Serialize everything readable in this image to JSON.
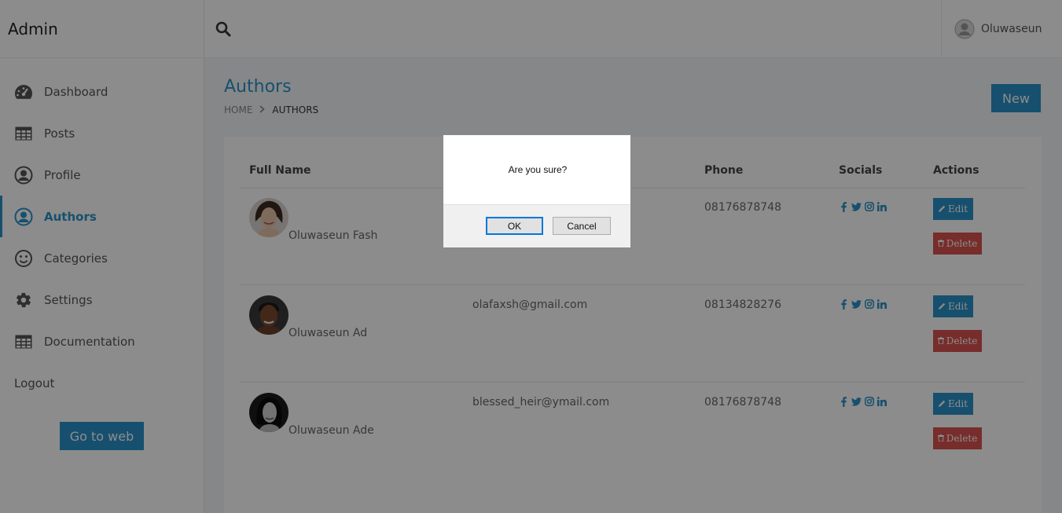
{
  "brand": "Admin",
  "sidebar": {
    "items": [
      {
        "label": "Dashboard",
        "icon": "dashboard-icon",
        "active": false
      },
      {
        "label": "Posts",
        "icon": "table-icon",
        "active": false
      },
      {
        "label": "Profile",
        "icon": "user-circle-icon",
        "active": false
      },
      {
        "label": "Authors",
        "icon": "user-circle-icon",
        "active": true
      },
      {
        "label": "Categories",
        "icon": "smile-icon",
        "active": false
      },
      {
        "label": "Settings",
        "icon": "gear-icon",
        "active": false
      },
      {
        "label": "Documentation",
        "icon": "table-icon",
        "active": false
      }
    ],
    "logout": "Logout",
    "go_web": "Go to web"
  },
  "topbar": {
    "search_icon": "search-icon",
    "user_name": "Oluwaseun"
  },
  "page": {
    "title": "Authors",
    "breadcrumb": {
      "home": "HOME",
      "current": "AUTHORS"
    },
    "new_button": "New"
  },
  "table": {
    "headers": {
      "name": "Full Name",
      "phone": "Phone",
      "socials": "Socials",
      "actions": "Actions"
    },
    "rows": [
      {
        "name": "Oluwaseun Fash",
        "email": "",
        "phone": "08176878748"
      },
      {
        "name": "Oluwaseun Ad",
        "email": "olafaxsh@gmail.com",
        "phone": "08134828276"
      },
      {
        "name": "Oluwaseun Ade",
        "email": "blessed_heir@ymail.com",
        "phone": "08176878748"
      }
    ],
    "edit_label": "Edit",
    "delete_label": "Delete"
  },
  "dialog": {
    "message": "Are you sure?",
    "ok": "OK",
    "cancel": "Cancel"
  },
  "colors": {
    "accent": "#2a93c9",
    "danger": "#d9534f"
  }
}
